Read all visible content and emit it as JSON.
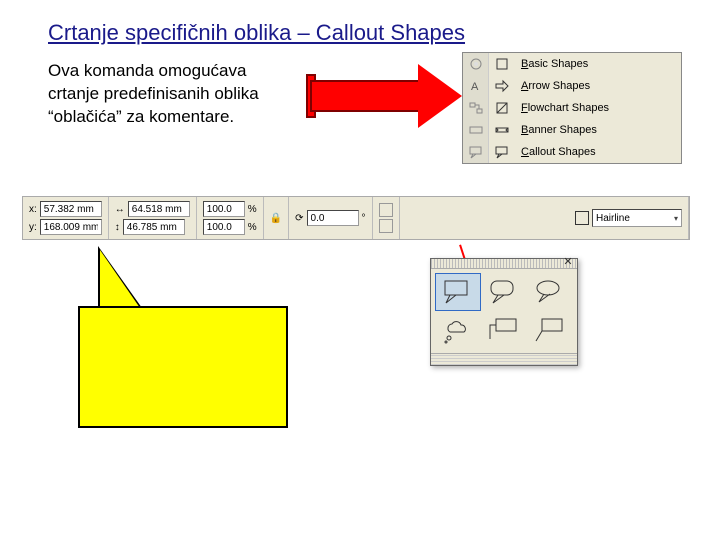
{
  "title": "Crtanje specifičnih oblika – Callout Shapes",
  "description": "Ova komanda omogućava crtanje predefinisanih oblika “oblačića” za komentare.",
  "flyout": {
    "items": [
      {
        "hot": "B",
        "rest": "asic Shapes",
        "left_ico": "star-icon",
        "row_ico": "square-icon"
      },
      {
        "hot": "A",
        "rest": "rrow Shapes",
        "left_ico": "text-icon",
        "row_ico": "arrow-right-icon"
      },
      {
        "hot": "F",
        "rest": "lowchart Shapes",
        "left_ico": "flowchart-icon",
        "row_ico": "diamond-icon"
      },
      {
        "hot": "B",
        "rest": "anner Shapes",
        "left_ico": "banner-icon",
        "row_ico": "ribbon-icon"
      },
      {
        "hot": "C",
        "rest": "allout Shapes",
        "left_ico": "callout-icon",
        "row_ico": "speech-icon"
      }
    ]
  },
  "statusbar": {
    "x_label": "x:",
    "x_value": "57.382 mm",
    "y_label": "y:",
    "y_value": "168.009 mm",
    "w_value": "64.518 mm",
    "h_value": "46.785 mm",
    "sx": "100.0",
    "sy": "100.0",
    "pct": "%",
    "angle": "0.0",
    "deg": "°",
    "linestyle": "Hairline",
    "lock": "🔒"
  },
  "palette": {
    "close": "✕",
    "shapes": [
      "rect-callout",
      "rounded-callout",
      "cloud-callout",
      "oval-callout",
      "line-callout-1",
      "line-callout-2"
    ],
    "selected_index": 0
  }
}
